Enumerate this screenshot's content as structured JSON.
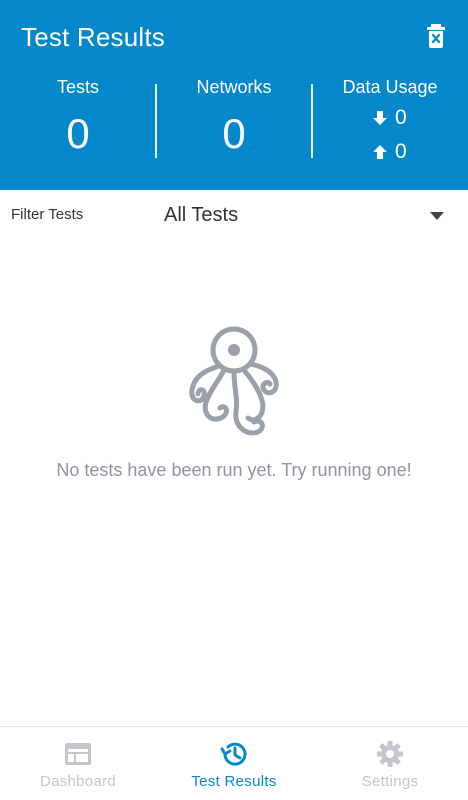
{
  "colors": {
    "header_bg": "#0588cb",
    "accent": "#0588cb",
    "inactive": "#c3c7cc",
    "empty_text": "#8e96a0"
  },
  "header": {
    "title": "Test Results",
    "delete_icon": "trash-icon"
  },
  "stats": {
    "tests": {
      "label": "Tests",
      "value": "0"
    },
    "networks": {
      "label": "Networks",
      "value": "0"
    },
    "data_usage": {
      "label": "Data Usage",
      "download": "0",
      "upload": "0"
    }
  },
  "filter": {
    "label": "Filter Tests",
    "selected": "All Tests"
  },
  "empty_state": {
    "icon": "octopus-icon",
    "message": "No tests have been run yet. Try running one!"
  },
  "bottom_nav": {
    "items": [
      {
        "label": "Dashboard",
        "icon": "dashboard-icon",
        "active": false
      },
      {
        "label": "Test Results",
        "icon": "history-icon",
        "active": true
      },
      {
        "label": "Settings",
        "icon": "gear-icon",
        "active": false
      }
    ]
  }
}
